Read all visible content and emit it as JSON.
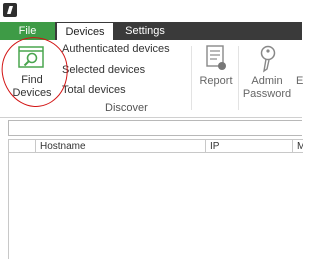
{
  "ribbon": {
    "tabs": [
      {
        "label": "File",
        "active": false,
        "color": "#3e9b46"
      },
      {
        "label": "Devices",
        "active": true
      },
      {
        "label": "Settings",
        "active": false
      }
    ],
    "discover_group": {
      "find_devices_label": "Find Devices",
      "links": [
        "Authenticated devices",
        "Selected devices",
        "Total devices"
      ],
      "group_label": "Discover"
    },
    "report_label": "Report",
    "admin_password_label": "Admin Password",
    "cut_off_label": "E"
  },
  "search": {
    "value": "",
    "placeholder": ""
  },
  "grid": {
    "columns": [
      "",
      "Hostname",
      "IP",
      "Ma"
    ]
  },
  "annotation": {
    "color": "#d21414",
    "icon_names": [
      "find-devices-icon",
      "report-icon",
      "key-icon"
    ]
  }
}
